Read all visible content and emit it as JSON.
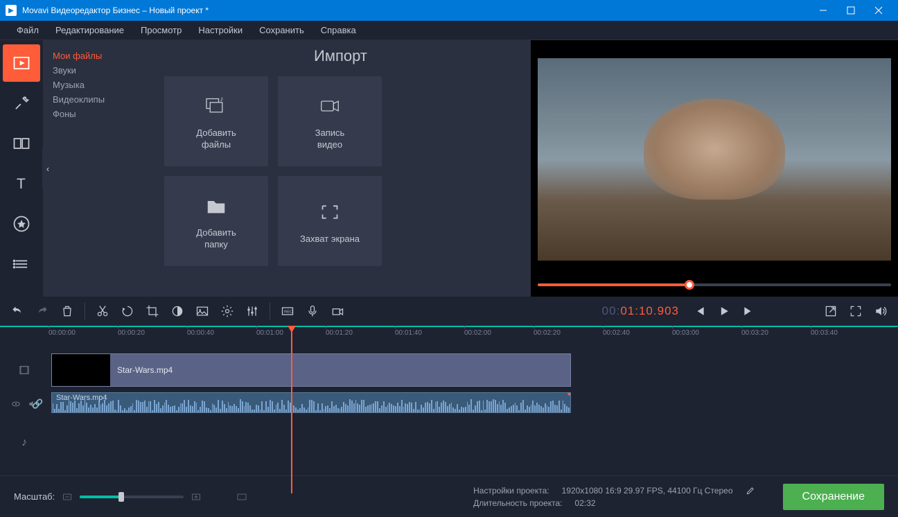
{
  "titlebar": {
    "title": "Movavi Видеоредактор Бизнес – Новый проект *"
  },
  "menubar": [
    "Файл",
    "Редактирование",
    "Просмотр",
    "Настройки",
    "Сохранить",
    "Справка"
  ],
  "import": {
    "title": "Импорт",
    "categories": [
      "Мои файлы",
      "Звуки",
      "Музыка",
      "Видеоклипы",
      "Фоны"
    ],
    "cards": [
      "Добавить\nфайлы",
      "Запись\nвидео",
      "Добавить\nпапку",
      "Захват экрана"
    ]
  },
  "timecode": {
    "h": "00",
    "m": "01",
    "s": "10",
    "ms": "903"
  },
  "ruler": [
    "00:00:00",
    "00:00:20",
    "00:00:40",
    "00:01:00",
    "00:01:20",
    "00:01:40",
    "00:02:00",
    "00:02:20",
    "00:02:40",
    "00:03:00",
    "00:03:20",
    "00:03:40"
  ],
  "clips": {
    "video": "Star-Wars.mp4",
    "audio": "Star-Wars.mp4"
  },
  "status": {
    "zoom_label": "Масштаб:",
    "settings_label": "Настройки проекта:",
    "settings_value": "1920x1080 16:9 29.97 FPS, 44100 Гц Стерео",
    "duration_label": "Длительность проекта:",
    "duration_value": "02:32",
    "save": "Сохранение"
  }
}
